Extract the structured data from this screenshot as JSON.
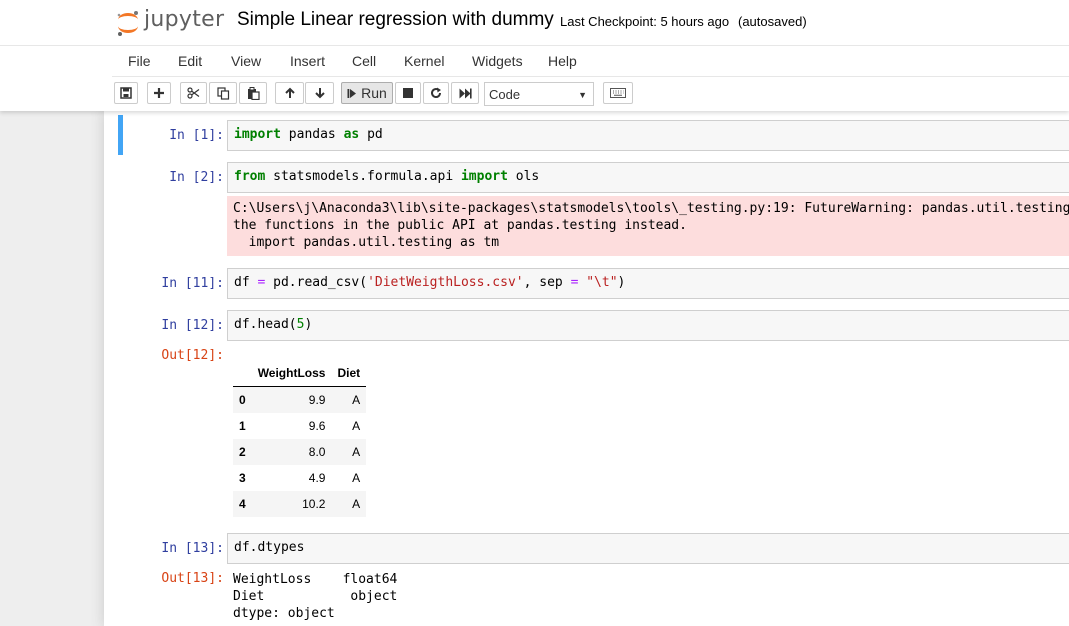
{
  "app": {
    "logo_text": "jupyter",
    "notebook_name": "Simple Linear regression with dummy",
    "checkpoint": "Last Checkpoint: 5 hours ago",
    "autosave": "(autosaved)"
  },
  "menu": [
    "File",
    "Edit",
    "View",
    "Insert",
    "Cell",
    "Kernel",
    "Widgets",
    "Help"
  ],
  "toolbar": {
    "run_label": "Run",
    "cell_type": "Code",
    "icons": [
      "save-icon",
      "plus-icon",
      "scissors-icon",
      "copy-icon",
      "paste-icon",
      "arrow-up-icon",
      "arrow-down-icon",
      "step-forward-icon",
      "stop-icon",
      "restart-icon",
      "fast-forward-icon",
      "keyboard-icon"
    ]
  },
  "cells": {
    "c1": {
      "prompt": "In [1]:"
    },
    "c2": {
      "prompt": "In [2]:",
      "stderr": "C:\\Users\\j\\Anaconda3\\lib\\site-packages\\statsmodels\\tools\\_testing.py:19: FutureWarning: pandas.util.testing is deprecated. Use\nthe functions in the public API at pandas.testing instead.\n  import pandas.util.testing as tm"
    },
    "c3": {
      "prompt": "In [11]:"
    },
    "c4": {
      "prompt": "In [12]:",
      "out_prompt": "Out[12]:"
    },
    "c5": {
      "prompt": "In [13]:",
      "out_prompt": "Out[13]:",
      "output": "WeightLoss    float64\nDiet           object\ndtype: object"
    }
  },
  "dataframe": {
    "columns": [
      "WeightLoss",
      "Diet"
    ],
    "rows": [
      {
        "index": "0",
        "WeightLoss": "9.9",
        "Diet": "A"
      },
      {
        "index": "1",
        "WeightLoss": "9.6",
        "Diet": "A"
      },
      {
        "index": "2",
        "WeightLoss": "8.0",
        "Diet": "A"
      },
      {
        "index": "3",
        "WeightLoss": "4.9",
        "Diet": "A"
      },
      {
        "index": "4",
        "WeightLoss": "10.2",
        "Diet": "A"
      }
    ]
  },
  "colors": {
    "in_prompt": "#303f9f",
    "out_prompt": "#d84315",
    "keyword": "#008000",
    "string": "#ba2121",
    "stderr_bg": "#fddddd",
    "selected_cell_border": "#42a5f5",
    "logo_orange": "#f37726"
  }
}
